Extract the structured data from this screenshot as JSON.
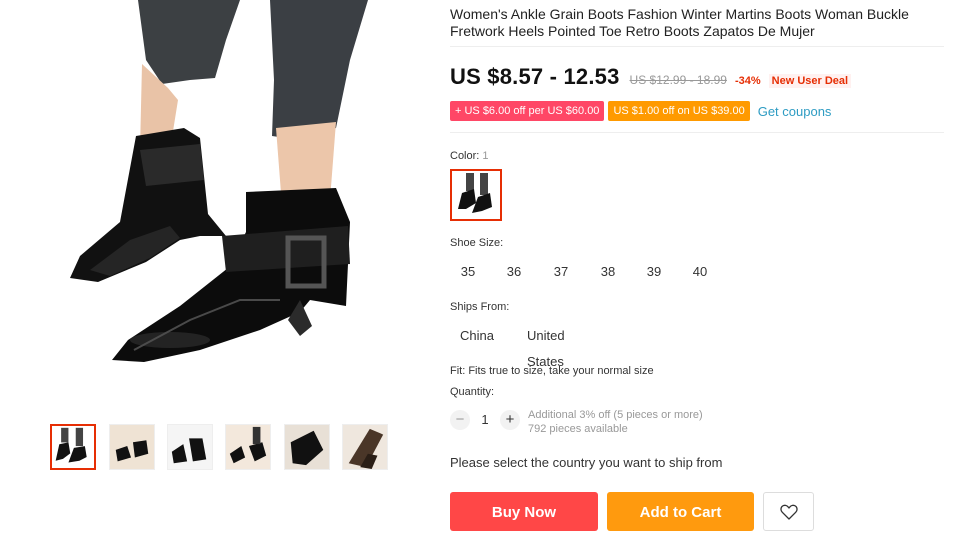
{
  "product": {
    "title": "Women's Ankle Grain Boots Fashion Winter Martins Boots Woman Buckle Fretwork Heels Pointed Toe Retro Boots Zapatos De Mujer"
  },
  "price": {
    "current": "US $8.57 - 12.53",
    "original": "US $12.99 - 18.99",
    "discount": "-34%",
    "badge": "New User Deal"
  },
  "coupons": {
    "items": [
      {
        "label": "+ US $6.00 off per US $60.00",
        "color": "#ff4766"
      },
      {
        "label": "US $1.00 off on US $39.00",
        "color": "#ff9a00"
      }
    ],
    "link": "Get coupons"
  },
  "color": {
    "label": "Color:",
    "count": "1"
  },
  "sizes": {
    "label": "Shoe Size:",
    "options": [
      "35",
      "36",
      "37",
      "38",
      "39",
      "40"
    ]
  },
  "ships_from": {
    "label": "Ships From:",
    "options": [
      "China",
      "United States"
    ]
  },
  "fit": "Fit: Fits true to size, take your normal size",
  "quantity": {
    "label": "Quantity:",
    "value": "1",
    "decrement": "−",
    "increment": "+",
    "note": "Additional 3% off (5 pieces or more)",
    "available": "792 pieces available"
  },
  "ship_message": "Please select the country you want to ship from",
  "actions": {
    "buy_now": "Buy Now",
    "add_to_cart": "Add to Cart",
    "wishlist_icon": "heart-outline-icon"
  },
  "theme": {
    "accent": "#e62e04",
    "buy": "#ff4747",
    "cart": "#ff9a0e",
    "link": "#2e9cc3"
  }
}
